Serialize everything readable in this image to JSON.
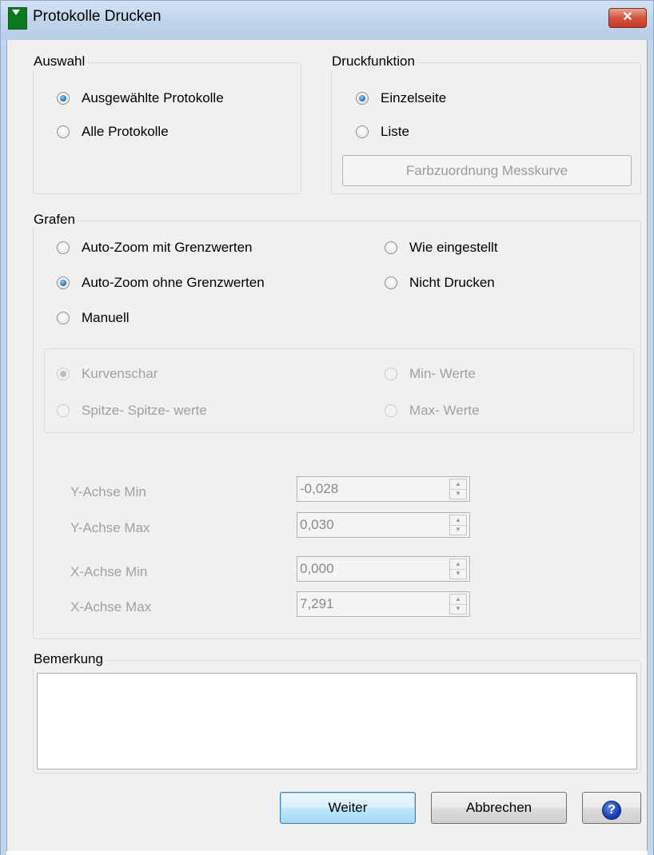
{
  "window": {
    "title": "Protokolle Drucken",
    "close_glyph": "✕"
  },
  "auswahl": {
    "legend": "Auswahl",
    "options": [
      {
        "label": "Ausgewählte Protokolle",
        "selected": true
      },
      {
        "label": "Alle Protokolle",
        "selected": false
      }
    ]
  },
  "druckfunktion": {
    "legend": "Druckfunktion",
    "options": [
      {
        "label": "Einzelseite",
        "selected": true
      },
      {
        "label": "Liste",
        "selected": false
      }
    ],
    "farb_button": "Farbzuordnung Messkurve"
  },
  "grafen": {
    "legend": "Grafen",
    "left_options": [
      {
        "label": "Auto-Zoom mit Grenzwerten",
        "selected": false
      },
      {
        "label": "Auto-Zoom ohne Grenzwerten",
        "selected": true
      },
      {
        "label": "Manuell",
        "selected": false
      }
    ],
    "right_options": [
      {
        "label": "Wie eingestellt",
        "selected": false
      },
      {
        "label": "Nicht Drucken",
        "selected": false
      }
    ],
    "sub_options": [
      {
        "label": "Kurvenschar",
        "selected": true
      },
      {
        "label": "Spitze- Spitze- werte",
        "selected": false
      },
      {
        "label": "Min- Werte",
        "selected": false
      },
      {
        "label": "Max- Werte",
        "selected": false
      }
    ],
    "fields": [
      {
        "label": "Y-Achse Min",
        "value": "-0,028"
      },
      {
        "label": "Y-Achse Max",
        "value": "0,030"
      },
      {
        "label": "X-Achse Min",
        "value": "0,000"
      },
      {
        "label": "X-Achse Max",
        "value": "7,291"
      }
    ]
  },
  "bemerkung": {
    "legend": "Bemerkung",
    "value": ""
  },
  "buttons": {
    "weiter": "Weiter",
    "abbrechen": "Abbrechen",
    "help_glyph": "?"
  },
  "icons": {
    "app": "app-logo-icon",
    "close": "close-icon",
    "help": "help-icon",
    "spin_up": "spin-up-icon",
    "spin_down": "spin-down-icon"
  }
}
